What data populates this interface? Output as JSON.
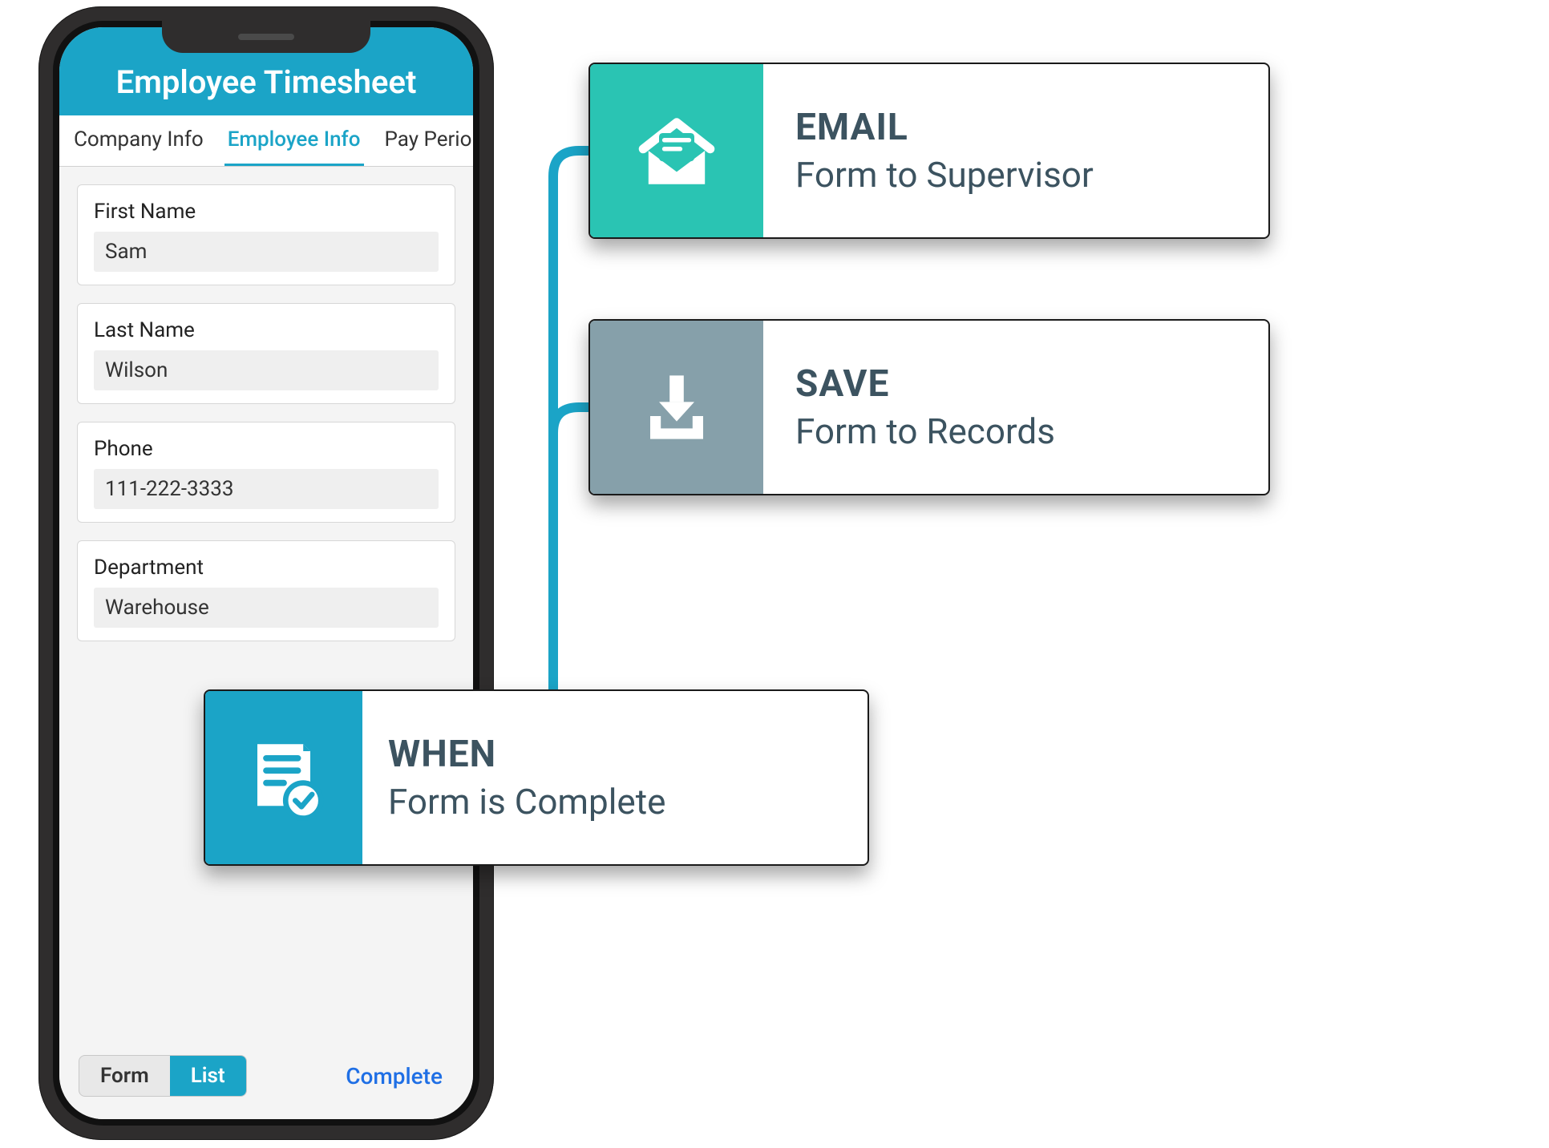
{
  "phone": {
    "title": "Employee Timesheet",
    "tabs": [
      "Company Info",
      "Employee Info",
      "Pay Perio"
    ],
    "active_tab_index": 1,
    "fields": [
      {
        "label": "First Name",
        "value": "Sam"
      },
      {
        "label": "Last Name",
        "value": "Wilson"
      },
      {
        "label": "Phone",
        "value": "111-222-3333"
      },
      {
        "label": "Department",
        "value": "Warehouse"
      }
    ],
    "segmented": {
      "left": "Form",
      "right": "List",
      "active": "right"
    },
    "complete_label": "Complete"
  },
  "cards": {
    "email": {
      "title": "EMAIL",
      "subtitle": "Form to Supervisor",
      "color": "#2ac4b3"
    },
    "save": {
      "title": "SAVE",
      "subtitle": "Form to Records",
      "color": "#86a0aa"
    },
    "when": {
      "title": "WHEN",
      "subtitle": "Form is Complete",
      "color": "#1ba4c7"
    }
  }
}
